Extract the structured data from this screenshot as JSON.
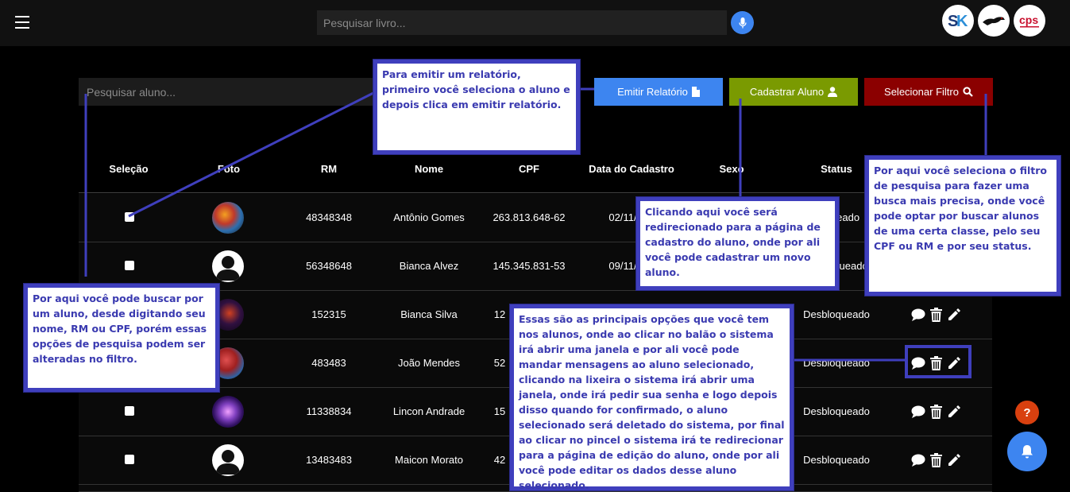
{
  "header": {
    "search_placeholder": "Pesquisar livro...",
    "logos": [
      "logo-sk",
      "logo-greyhound",
      "logo-cps"
    ]
  },
  "toolbar": {
    "student_search_placeholder": "Pesquisar aluno...",
    "report_label": "Emitir Relatório",
    "register_label": "Cadastrar Aluno",
    "filter_label": "Selecionar Filtro"
  },
  "table": {
    "headers": [
      "Seleção",
      "Foto",
      "RM",
      "Nome",
      "CPF",
      "Data do Cadastro",
      "Sexo",
      "Status"
    ],
    "rows": [
      {
        "rm": "48348348",
        "name": "Antônio Gomes",
        "cpf": "263.813.648-62",
        "date": "02/11/",
        "status": "ueado",
        "checked": true
      },
      {
        "rm": "56348648",
        "name": "Bianca Alvez",
        "cpf": "145.345.831-53",
        "date": "09/11/",
        "status": "queado",
        "checked": false
      },
      {
        "rm": "152315",
        "name": "Bianca Silva",
        "cpf": "12",
        "date": "",
        "status": "Desbloqueado",
        "checked": false
      },
      {
        "rm": "483483",
        "name": "João Mendes",
        "cpf": "52",
        "date": "",
        "status": "Desbloqueado",
        "checked": false
      },
      {
        "rm": "11338834",
        "name": "Lincon Andrade",
        "cpf": "15",
        "date": "",
        "status": "Desbloqueado",
        "checked": false
      },
      {
        "rm": "13483483",
        "name": "Maicon Morato",
        "cpf": "42",
        "date": "",
        "status": "Desbloqueado",
        "checked": false
      }
    ]
  },
  "callouts": {
    "report": "Para emitir um relatório, primeiro você seleciona o aluno e depois clica em emitir relatório.",
    "register": "Clicando aqui você será redirecionado para a página de cadastro do aluno, onde por ali você pode cadastrar um novo aluno.",
    "filter": "Por aqui você seleciona o filtro de pesquisa para fazer uma busca mais precisa, onde você pode optar por buscar alunos de uma certa classe, pelo seu CPF ou RM e por seu status.",
    "search": "Por aqui você pode buscar por um aluno, desde digitando seu nome, RM ou CPF, porém essas opções de pesquisa podem ser alteradas no filtro.",
    "actions": "Essas são as principais opções que você tem nos alunos, onde ao clicar no balão o sistema irá abrir uma janela e por ali você pode mandar mensagens ao aluno selecionado, clicando na lixeira o sistema irá abrir uma janela, onde irá pedir sua senha e logo depois disso quando for confirmado, o aluno selecionado será deletado do sistema, por final ao clicar no pincel o sistema irá te redirecionar para a página de edição do aluno, onde por ali você pode editar os dados desse aluno selecionado."
  },
  "floating": {
    "help_label": "?"
  },
  "colors": {
    "report_button": "#3d85f0",
    "register_button": "#7a9a01",
    "filter_button": "#8b0000",
    "callout_border": "#3f3fbd",
    "help_button": "#d9400f"
  }
}
